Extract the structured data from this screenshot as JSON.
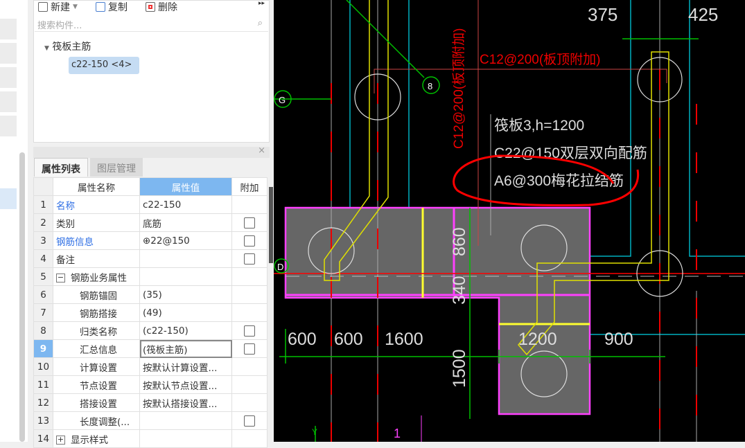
{
  "toolbar": {
    "new_label": "新建",
    "copy_label": "复制",
    "delete_label": "删除",
    "more": "▸▸"
  },
  "search": {
    "placeholder": "搜索构件..."
  },
  "tree": {
    "group": "筏板主筋",
    "item": "c22-150 <4>"
  },
  "properties": {
    "tabs": [
      "属性列表",
      "图层管理"
    ],
    "headers": [
      "属性名称",
      "属性值",
      "附加"
    ],
    "rows": [
      {
        "n": "1",
        "name": "名称",
        "value": "c22-150",
        "check": false,
        "link": true
      },
      {
        "n": "2",
        "name": "类别",
        "value": "底筋",
        "check": true
      },
      {
        "n": "3",
        "name": "钢筋信息",
        "value": "⊕22@150",
        "check": true,
        "link": true
      },
      {
        "n": "4",
        "name": "备注",
        "value": "",
        "check": true
      },
      {
        "n": "5",
        "name": "钢筋业务属性",
        "value": "",
        "check": false,
        "expander": "−"
      },
      {
        "n": "6",
        "name": "钢筋锚固",
        "value": "(35)",
        "check": false
      },
      {
        "n": "7",
        "name": "钢筋搭接",
        "value": "(49)",
        "check": false
      },
      {
        "n": "8",
        "name": "归类名称",
        "value": "(c22-150)",
        "check": true
      },
      {
        "n": "9",
        "name": "汇总信息",
        "value": "(筏板主筋)",
        "check": true,
        "selected": true
      },
      {
        "n": "10",
        "name": "计算设置",
        "value": "按默认计算设置...",
        "check": false
      },
      {
        "n": "11",
        "name": "节点设置",
        "value": "按默认节点设置...",
        "check": false
      },
      {
        "n": "12",
        "name": "搭接设置",
        "value": "按默认搭接设置...",
        "check": false
      },
      {
        "n": "13",
        "name": "长度调整(...",
        "value": "",
        "check": true
      },
      {
        "n": "14",
        "name": "显示样式",
        "value": "",
        "check": false,
        "expander": "+"
      }
    ]
  },
  "cad": {
    "axis_labels": {
      "G": "G",
      "eight": "8",
      "D": "D",
      "Y": "Y",
      "one": "1"
    },
    "annot_red_h": "C12@200(板顶附加)",
    "annot_red_v": "C12@200(板顶附加)",
    "note1": "筏板3,h=1200",
    "note2": "C22@150双层双向配筋",
    "note3": "A6@300梅花拉结筋",
    "dims_top": [
      "375",
      "425"
    ],
    "dims_bottom": [
      "600",
      "600",
      "1600",
      "1200",
      "900"
    ],
    "dims_vertical": [
      "860",
      "340",
      "1500"
    ],
    "colors": {
      "bg": "#000000",
      "slab": "#666666",
      "edge": "#ff40ff",
      "rebar": "#e0e000",
      "grid": "#00c000",
      "axis": "#ff0000",
      "cyan": "#00b0c0"
    }
  }
}
